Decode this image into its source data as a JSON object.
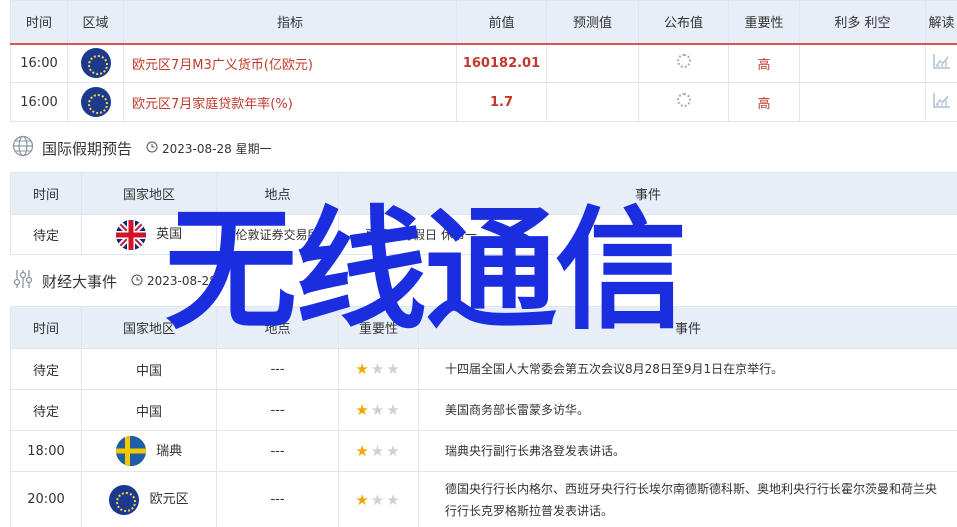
{
  "table1": {
    "headers": [
      "时间",
      "区域",
      "指标",
      "前值",
      "预测值",
      "公布值",
      "重要性",
      "利多 利空",
      "解读"
    ],
    "rows": [
      {
        "time": "16:00",
        "region_flag": "eu-flag-icon",
        "indicator": "欧元区7月M3广义货币(亿欧元)",
        "prev": "160182.01",
        "forecast": "",
        "actual": "",
        "importance": "高",
        "bull_bear": ""
      },
      {
        "time": "16:00",
        "region_flag": "eu-flag-icon",
        "indicator": "欧元区7月家庭贷款年率(%)",
        "prev": "1.7",
        "forecast": "",
        "actual": "",
        "importance": "高",
        "bull_bear": ""
      }
    ]
  },
  "holiday": {
    "title": "国际假期预告",
    "date": "2023-08-28 星期一",
    "headers": [
      "时间",
      "国家地区",
      "地点",
      "事件"
    ],
    "rows": [
      {
        "time": "待定",
        "country": "英国",
        "place": "伦敦证券交易所",
        "event": "夏季银行假日 休市一"
      }
    ]
  },
  "events": {
    "title": "财经大事件",
    "date": "2023-08-28",
    "headers": [
      "时间",
      "国家地区",
      "地点",
      "重要性",
      "事件"
    ],
    "rows": [
      {
        "time": "待定",
        "country": "中国",
        "place": "---",
        "stars": 1,
        "event": "十四届全国人大常委会第五次会议8月28日至9月1日在京举行。"
      },
      {
        "time": "待定",
        "country": "中国",
        "place": "---",
        "stars": 1,
        "event": "美国商务部长雷蒙多访华。"
      },
      {
        "time": "18:00",
        "country": "瑞典",
        "place": "---",
        "stars": 1,
        "event": "瑞典央行副行长弗洛登发表讲话。"
      },
      {
        "time": "20:00",
        "country": "欧元区",
        "place": "---",
        "stars": 1,
        "event": "德国央行行长内格尔、西班牙央行行长埃尔南德斯德科斯、奥地利央行行长霍尔茨曼和荷兰央行行长克罗格斯拉普发表讲话。"
      }
    ]
  },
  "watermark": "无线通信",
  "colors": {
    "accent_red": "#c0392b",
    "header_bg": "#e7eef7",
    "star": "#f0a800",
    "watermark": "#1a2ee0"
  }
}
